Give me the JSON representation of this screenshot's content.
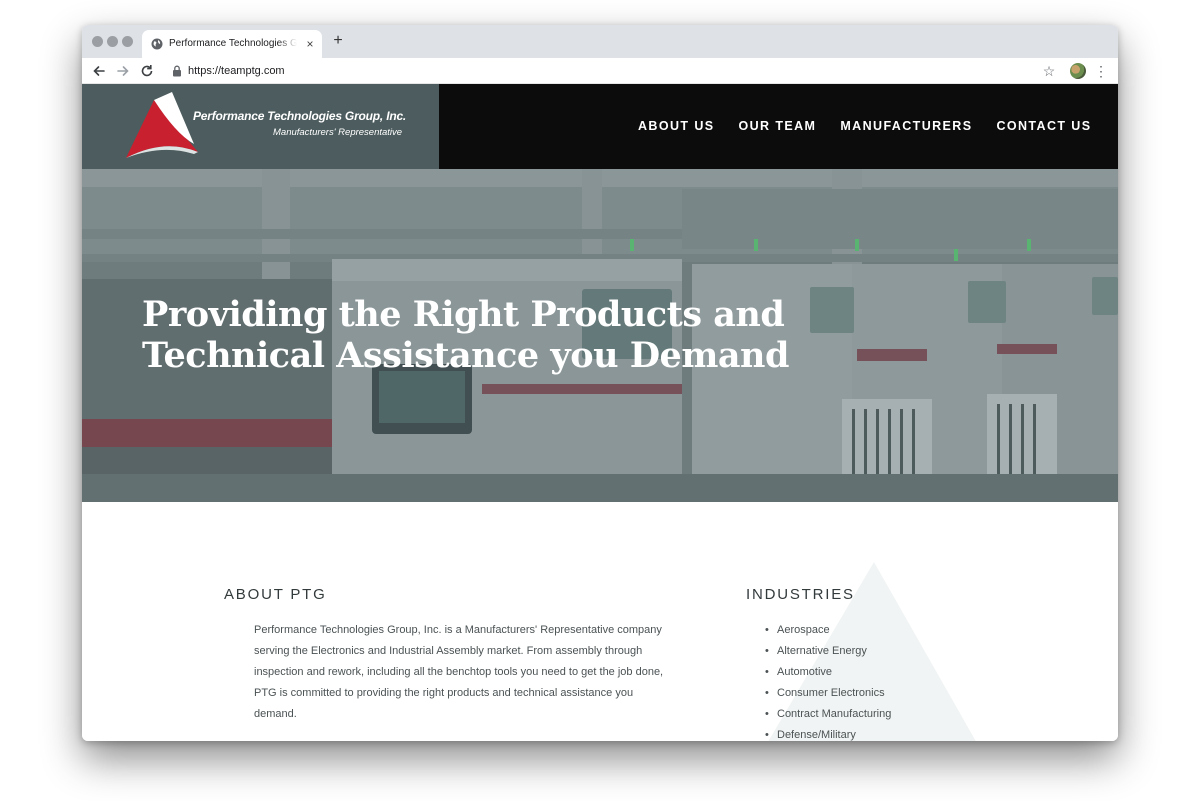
{
  "browser": {
    "tab_title": "Performance Technologies Group, Inc.",
    "tab_close": "×",
    "new_tab": "+",
    "url": "https://teamptg.com",
    "star_glyph": "☆",
    "menu_glyph": "⋮"
  },
  "site": {
    "logo": {
      "name": "Performance Technologies Group, Inc.",
      "tagline": "Manufacturers' Representative",
      "mark_color": "#c8202e"
    },
    "nav": [
      "ABOUT US",
      "OUR TEAM",
      "MANUFACTURERS",
      "CONTACT US"
    ],
    "hero": {
      "title": "Providing the Right Products and Technical Assistance you Demand"
    },
    "about": {
      "heading": "ABOUT PTG",
      "body": "Performance Technologies Group, Inc. is a Manufacturers' Representative company serving the Electronics and Industrial Assembly market. From assembly through inspection and rework, including all the benchtop tools you need to get the job done, PTG is committed to providing the right products and technical assistance you demand."
    },
    "industries": {
      "heading": "INDUSTRIES",
      "items": [
        "Aerospace",
        "Alternative Energy",
        "Automotive",
        "Consumer Electronics",
        "Contract Manufacturing",
        "Defense/Military"
      ]
    }
  },
  "colors": {
    "header_bg": "#0c0c0c",
    "logo_bg": "#4d5c5e",
    "hero_tint": "#5f6e6f",
    "text": "#4b5254"
  }
}
